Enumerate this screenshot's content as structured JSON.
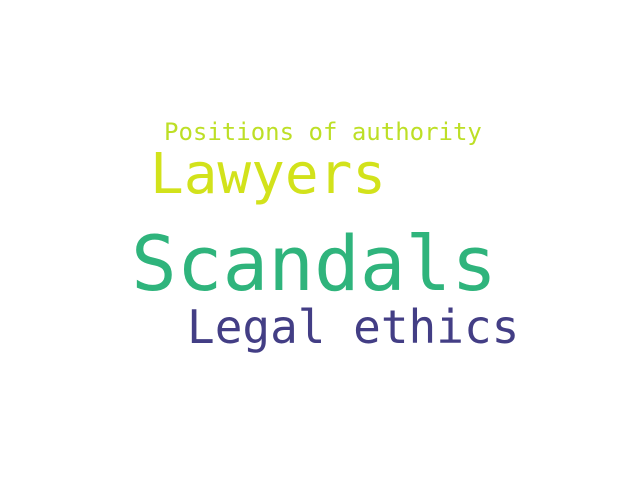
{
  "word_cloud": {
    "words": [
      {
        "text": "Positions of authority",
        "color": "#bddf26"
      },
      {
        "text": "Lawyers",
        "color": "#d2e21b"
      },
      {
        "text": "Scandals",
        "color": "#2fb47c"
      },
      {
        "text": "Legal ethics",
        "color": "#433e85"
      }
    ]
  }
}
